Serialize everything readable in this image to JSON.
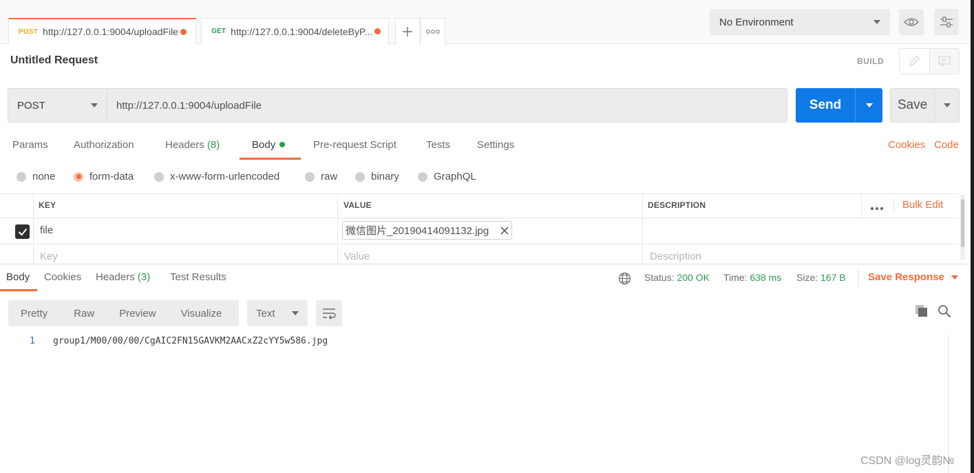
{
  "tabs": [
    {
      "method": "POST",
      "url": "http://127.0.0.1:9004/uploadFile"
    },
    {
      "method": "GET",
      "url": "http://127.0.0.1:9004/deleteByP..."
    }
  ],
  "environment": {
    "selected": "No Environment"
  },
  "request": {
    "title": "Untitled Request",
    "build_label": "BUILD",
    "method": "POST",
    "url": "http://127.0.0.1:9004/uploadFile",
    "send_label": "Send",
    "save_label": "Save"
  },
  "request_tabs": {
    "params": "Params",
    "authorization": "Authorization",
    "headers": "Headers",
    "headers_count": "(8)",
    "body": "Body",
    "pre_request": "Pre-request Script",
    "tests": "Tests",
    "settings": "Settings",
    "cookies": "Cookies",
    "code": "Code"
  },
  "body_types": {
    "none": "none",
    "form_data": "form-data",
    "urlencoded": "x-www-form-urlencoded",
    "raw": "raw",
    "binary": "binary",
    "graphql": "GraphQL",
    "selected": "form-data"
  },
  "form_table": {
    "headers": {
      "key": "KEY",
      "value": "VALUE",
      "description": "DESCRIPTION"
    },
    "bulk_edit": "Bulk Edit",
    "rows": [
      {
        "checked": true,
        "key": "file",
        "value": "微信图片_20190414091132.jpg",
        "description": ""
      }
    ],
    "placeholders": {
      "key": "Key",
      "value": "Value",
      "description": "Description"
    }
  },
  "response": {
    "tabs": {
      "body": "Body",
      "cookies": "Cookies",
      "headers": "Headers",
      "headers_count": "(3)",
      "test_results": "Test Results"
    },
    "status_label": "Status:",
    "status_value": "200 OK",
    "time_label": "Time:",
    "time_value": "638 ms",
    "size_label": "Size:",
    "size_value": "167 B",
    "save_response": "Save Response",
    "views": {
      "pretty": "Pretty",
      "raw": "Raw",
      "preview": "Preview",
      "visualize": "Visualize"
    },
    "format": "Text",
    "lines": [
      {
        "number": "1",
        "text": "group1/M00/00/00/CgAIC2FN15GAVKM2AACxZ2cYY5w586.jpg"
      }
    ]
  },
  "watermark": "CSDN @log灵韵№",
  "colors": {
    "accent": "#f26b3a",
    "send": "#0f7ae5",
    "success": "#2a9d4d"
  }
}
